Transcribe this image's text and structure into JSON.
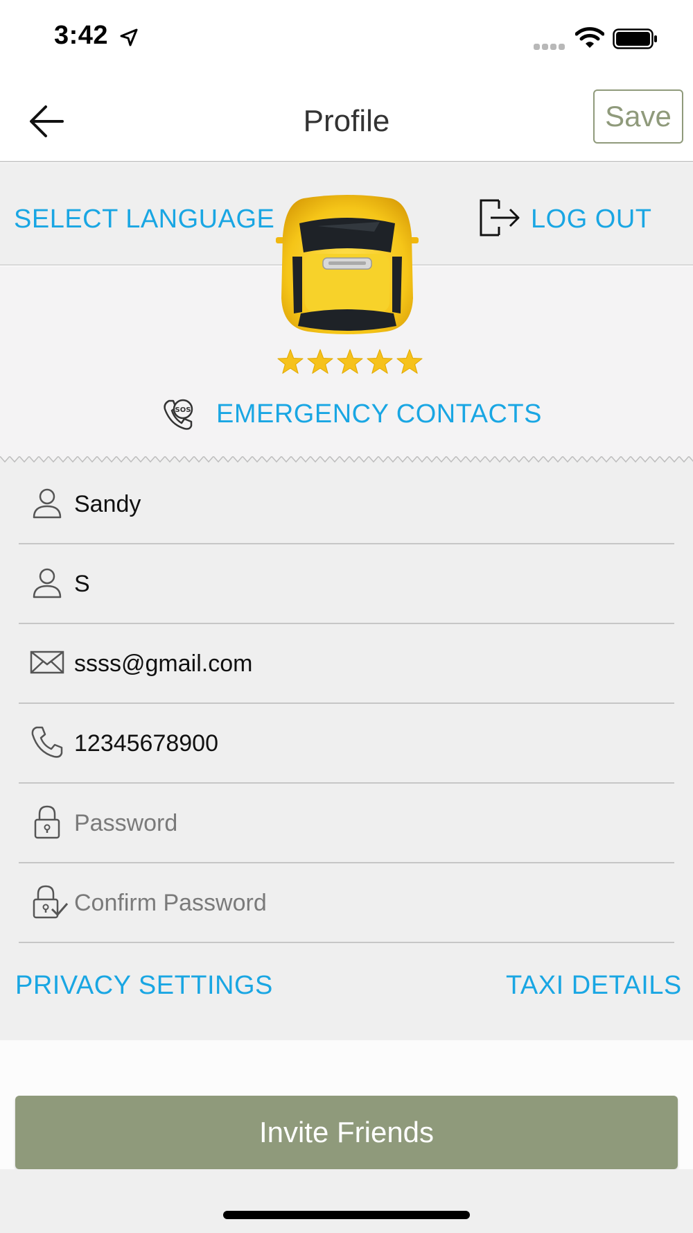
{
  "status_bar": {
    "time": "3:42"
  },
  "nav": {
    "title": "Profile",
    "save_label": "Save"
  },
  "header_links": {
    "select_language": "SELECT LANGUAGE",
    "log_out": "LOG OUT"
  },
  "profile": {
    "rating": 5,
    "rating_max": 5,
    "emergency_contacts_label": "EMERGENCY CONTACTS"
  },
  "form": {
    "fields": [
      {
        "icon": "person-icon",
        "value": "Sandy",
        "placeholder": ""
      },
      {
        "icon": "person-icon",
        "value": "S",
        "placeholder": ""
      },
      {
        "icon": "mail-icon",
        "value": "ssss@gmail.com",
        "placeholder": ""
      },
      {
        "icon": "phone-icon",
        "value": "12345678900",
        "placeholder": ""
      },
      {
        "icon": "lock-icon",
        "value": "",
        "placeholder": "Password"
      },
      {
        "icon": "lock-check-icon",
        "value": "",
        "placeholder": "Confirm Password"
      }
    ]
  },
  "footer_links": {
    "privacy_settings": "PRIVACY SETTINGS",
    "taxi_details": "TAXI DETAILS"
  },
  "invite": {
    "label": "Invite Friends"
  },
  "colors": {
    "accent_link": "#19a6e3",
    "button_green": "#8f9a7b",
    "star": "#f6c21c",
    "taxi_yellow": "#f5c518"
  }
}
